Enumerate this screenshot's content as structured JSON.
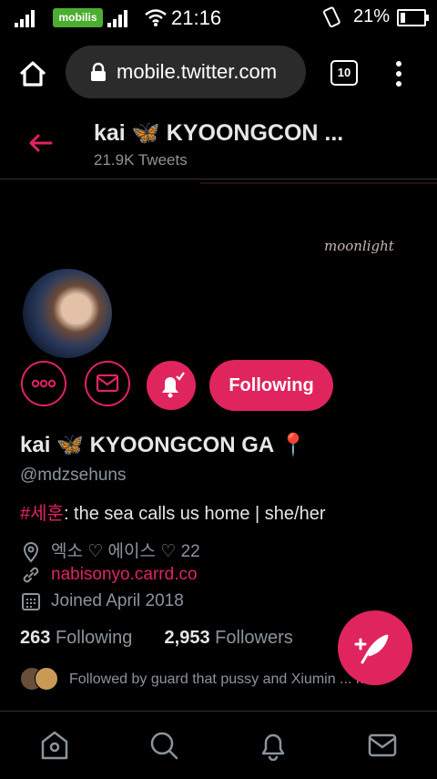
{
  "status_bar": {
    "time": "21:16",
    "battery": "21%",
    "carrier": "mobilis"
  },
  "browser": {
    "url": "mobile.twitter.com",
    "tab_count": "10"
  },
  "profile_header": {
    "title": "kai 🦋 KYOONGCON ...",
    "tweets": "21.9K Tweets"
  },
  "banner": {
    "text": "moonlight"
  },
  "actions": {
    "following_label": "Following"
  },
  "profile": {
    "display_name": "kai 🦋 KYOONGCON GA 📍",
    "handle": "@mdzsehuns",
    "bio_hashtag": "#세훈",
    "bio_text": ": the sea calls us home | she/her",
    "location": "엑소 ♡ 에이스 ♡ 22",
    "website": "nabisonyo.carrd.co",
    "joined": "Joined April 2018",
    "following_count": "263",
    "following_label": "Following",
    "followers_count": "2,953",
    "followers_label": "Followers",
    "followed_by": "Followed by guard that pussy and Xiumin ... Maro"
  },
  "colors": {
    "accent": "#e0245e",
    "background": "#000000",
    "muted": "#8b949b"
  },
  "icons": [
    "home-icon",
    "lock-icon",
    "menu-dots-icon",
    "back-arrow-icon",
    "more-icon",
    "mail-icon",
    "bell-icon",
    "location-icon",
    "link-icon",
    "calendar-icon",
    "compose-icon",
    "search-icon"
  ]
}
